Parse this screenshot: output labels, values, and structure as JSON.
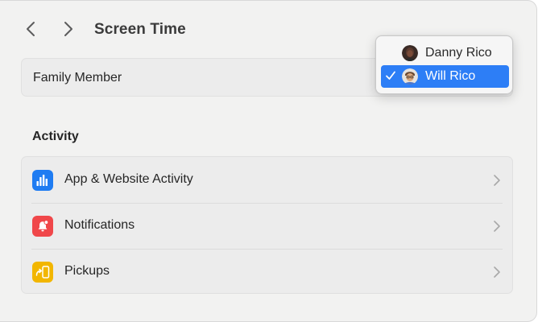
{
  "window": {
    "title": "Screen Time"
  },
  "family": {
    "label": "Family Member",
    "options": [
      {
        "name": "Danny Rico",
        "selected": false
      },
      {
        "name": "Will Rico",
        "selected": true
      }
    ]
  },
  "activity": {
    "heading": "Activity",
    "rows": [
      {
        "label": "App & Website Activity",
        "icon": "bar-chart-icon",
        "color": "#1f7cf2"
      },
      {
        "label": "Notifications",
        "icon": "notification-bell-icon",
        "color": "#f0474a"
      },
      {
        "label": "Pickups",
        "icon": "pickup-phone-icon",
        "color": "#f2b600"
      }
    ]
  },
  "colors": {
    "accent": "#2d7ef6",
    "background": "#f2f2f1"
  }
}
